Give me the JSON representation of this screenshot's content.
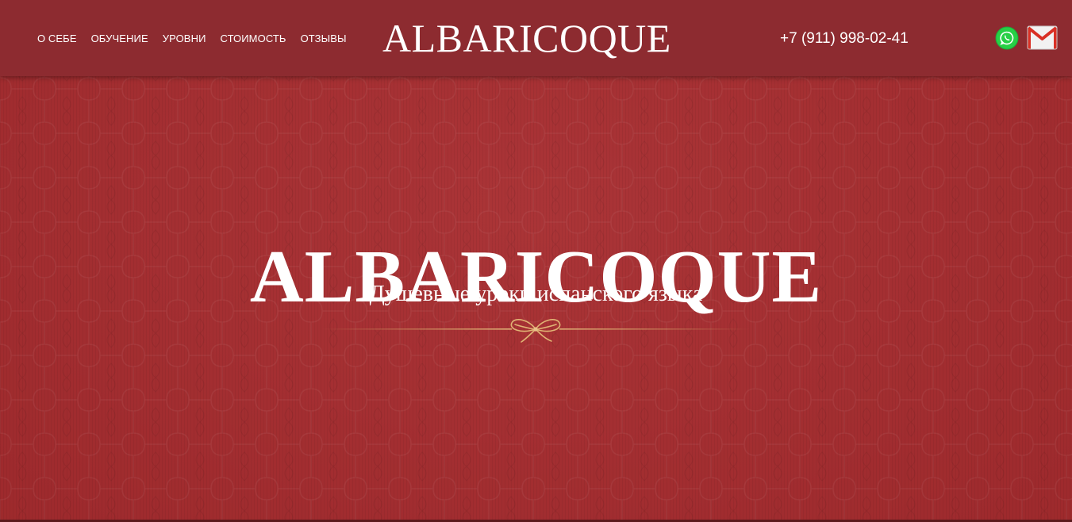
{
  "header": {
    "nav": [
      {
        "label": "О СЕБЕ"
      },
      {
        "label": "ОБУЧЕНИЕ"
      },
      {
        "label": "УРОВНИ"
      },
      {
        "label": "СТОИМОСТЬ"
      },
      {
        "label": "ОТЗЫВЫ"
      }
    ],
    "logo": "ALBARICOQUE",
    "phone": "+7 (911) 998-02-41",
    "icons": {
      "whatsapp": "whatsapp-icon",
      "mail": "gmail-icon"
    }
  },
  "hero": {
    "title": "ALBARICOQUE",
    "subtitle": "Душевные уроки испанского языка",
    "ornament": "ribbon-bow-divider"
  },
  "colors": {
    "header_bg": "#8d2b30",
    "hero_bg": "#a72c2f",
    "text": "#ffffff",
    "gold": "#d9a866",
    "whatsapp_green": "#25d366",
    "mail_red": "#d93025"
  }
}
